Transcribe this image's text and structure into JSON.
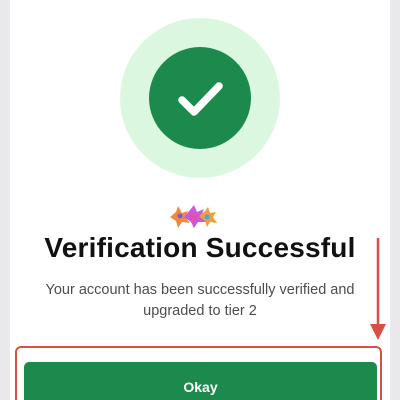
{
  "dialog": {
    "title": "Verification Successful",
    "message": "Your account has been successfully verified and upgraded to tier 2",
    "primary_button_label": "Okay",
    "status_icon": "check-icon",
    "decoration_icon": "sparkle-icon"
  },
  "annotation": {
    "arrow_icon": "arrow-down-icon",
    "highlight_target": "okay-button"
  },
  "colors": {
    "primary": "#1b8a4c",
    "halo": "#dcf7df",
    "annotation": "#d94f43",
    "title_text": "#111111",
    "body_text": "#4d4d4d"
  }
}
